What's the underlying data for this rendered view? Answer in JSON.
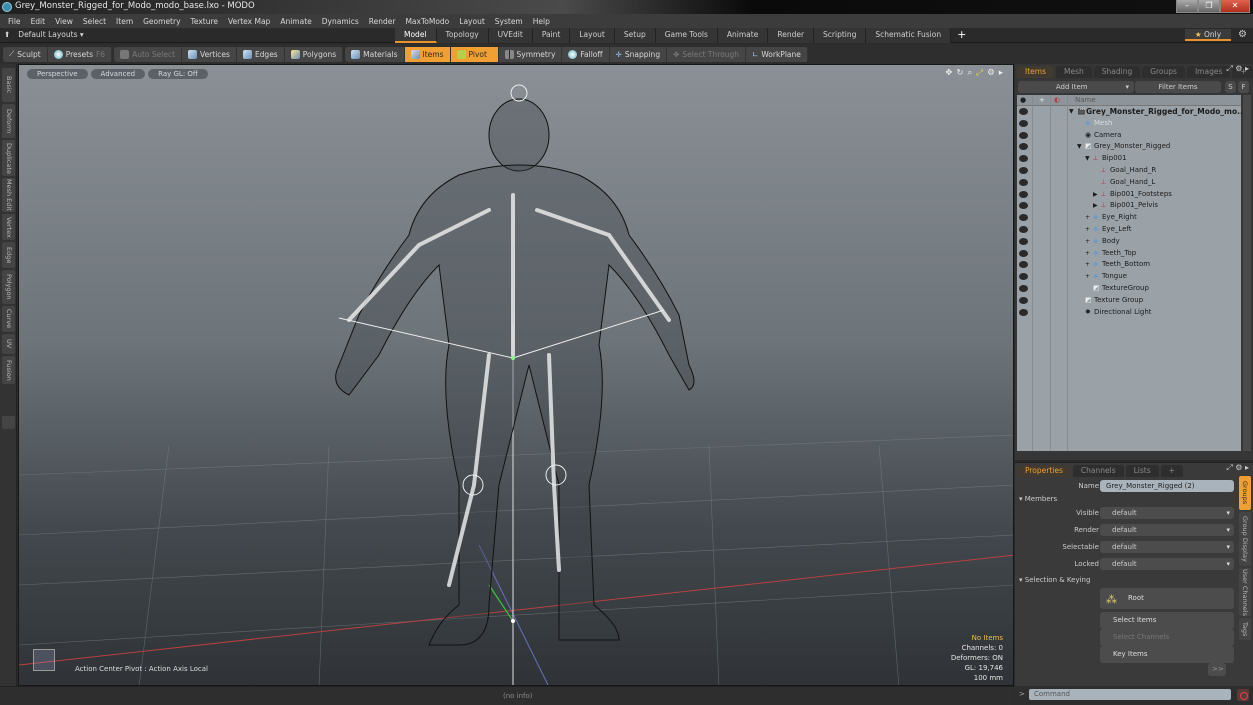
{
  "window": {
    "title": "Grey_Monster_Rigged_for_Modo_modo_base.lxo - MODO",
    "min": "–",
    "max": "❐",
    "close": "✕"
  },
  "menu": [
    "File",
    "Edit",
    "View",
    "Select",
    "Item",
    "Geometry",
    "Texture",
    "Vertex Map",
    "Animate",
    "Dynamics",
    "Render",
    "MaxToModo",
    "Layout",
    "System",
    "Help"
  ],
  "layouts": {
    "label": "Default Layouts ▾",
    "tabs": [
      "Model",
      "Topology",
      "UVEdit",
      "Paint",
      "Layout",
      "Setup",
      "Game Tools",
      "Animate",
      "Render",
      "Scripting",
      "Schematic Fusion"
    ],
    "active_tab": "Model",
    "plus": "+",
    "only": "Only"
  },
  "toolbar": {
    "sculpt": "Sculpt",
    "presets": "Presets",
    "presets_key": "F6",
    "auto_select": "Auto Select",
    "vertices": "Vertices",
    "edges": "Edges",
    "polygons": "Polygons",
    "materials": "Materials",
    "items": "Items",
    "pivot": "Pivot",
    "symmetry": "Symmetry",
    "falloff": "Falloff",
    "snapping": "Snapping",
    "select_through": "Select Through",
    "workplane": "WorkPlane"
  },
  "left_tabs": [
    "Basic",
    "Deform",
    "Duplicate",
    "Mesh Edit",
    "Vertex",
    "Edge",
    "Polygon",
    "Curve",
    "UV",
    "Fusion"
  ],
  "viewport": {
    "view": "Perspective",
    "shading": "Advanced",
    "raygl": "Ray GL: Off",
    "action_center": "Action Center Pivot : Action Axis Local",
    "status": {
      "items": "No Items",
      "channels": "Channels: 0",
      "deformers": "Deformers: ON",
      "gl": "GL: 19,746",
      "unit": "100 mm"
    }
  },
  "bottom": {
    "info": "(no info)"
  },
  "items_panel": {
    "tabs": [
      "Items",
      "Mesh ...",
      "Shading",
      "Groups",
      "Images"
    ],
    "active_tab": "Items",
    "add_item": "Add Item",
    "filter": "Filter Items",
    "s": "S",
    "f": "F",
    "col_name": "Name",
    "tree": [
      {
        "label": "Grey_Monster_Rigged_for_Modo_mo...",
        "depth": 0,
        "style": "bold",
        "expander": "▼",
        "icon": "scene"
      },
      {
        "label": "Mesh",
        "depth": 1,
        "style": "dim",
        "expander": "",
        "icon": "mesh"
      },
      {
        "label": "Camera",
        "depth": 1,
        "style": "",
        "expander": "",
        "icon": "camera"
      },
      {
        "label": "Grey_Monster_Rigged",
        "depth": 1,
        "style": "",
        "expander": "▼",
        "icon": "group"
      },
      {
        "label": "Bip001",
        "depth": 2,
        "style": "",
        "expander": "▼",
        "icon": "bone"
      },
      {
        "label": "Goal_Hand_R",
        "depth": 3,
        "style": "",
        "expander": "",
        "icon": "bone"
      },
      {
        "label": "Goal_Hand_L",
        "depth": 3,
        "style": "",
        "expander": "",
        "icon": "bone"
      },
      {
        "label": "Bip001_Footsteps",
        "depth": 3,
        "style": "",
        "expander": "▶",
        "icon": "bone"
      },
      {
        "label": "Bip001_Pelvis",
        "depth": 3,
        "style": "",
        "expander": "▶",
        "icon": "bone"
      },
      {
        "label": "Eye_Right",
        "depth": 2,
        "style": "",
        "expander": "+",
        "icon": "mesh"
      },
      {
        "label": "Eye_Left",
        "depth": 2,
        "style": "",
        "expander": "+",
        "icon": "mesh"
      },
      {
        "label": "Body",
        "depth": 2,
        "style": "",
        "expander": "+",
        "icon": "mesh"
      },
      {
        "label": "Teeth_Top",
        "depth": 2,
        "style": "",
        "expander": "+",
        "icon": "mesh"
      },
      {
        "label": "Teeth_Bottom",
        "depth": 2,
        "style": "",
        "expander": "+",
        "icon": "mesh"
      },
      {
        "label": "Tongue",
        "depth": 2,
        "style": "",
        "expander": "+",
        "icon": "mesh"
      },
      {
        "label": "TextureGroup",
        "depth": 2,
        "style": "",
        "expander": "",
        "icon": "group"
      },
      {
        "label": "Texture Group",
        "depth": 1,
        "style": "",
        "expander": "",
        "icon": "group"
      },
      {
        "label": "Directional Light",
        "depth": 1,
        "style": "",
        "expander": "",
        "icon": "light"
      }
    ]
  },
  "properties": {
    "tabs": [
      "Properties",
      "Channels",
      "Lists"
    ],
    "active_tab": "Properties",
    "name_label": "Name",
    "name_value": "Grey_Monster_Rigged (2)",
    "members_section": "Members",
    "fields": [
      {
        "label": "Visible",
        "value": "default"
      },
      {
        "label": "Render",
        "value": "default"
      },
      {
        "label": "Selectable",
        "value": "default"
      },
      {
        "label": "Locked",
        "value": "default"
      }
    ],
    "selection_section": "Selection & Keying",
    "root": "Root",
    "select_items": "Select Items",
    "select_channels": "Select Channels",
    "key_items": "Key Items",
    "more": ">>",
    "side_tabs": [
      "Groups",
      "Group Display",
      "User Channels",
      "Tags"
    ],
    "active_side_tab": "Groups"
  },
  "command": {
    "placeholder": "Command",
    "prompt": ">"
  },
  "colors": {
    "accent": "#f0a032",
    "status_yellow": "#e8c04a"
  }
}
